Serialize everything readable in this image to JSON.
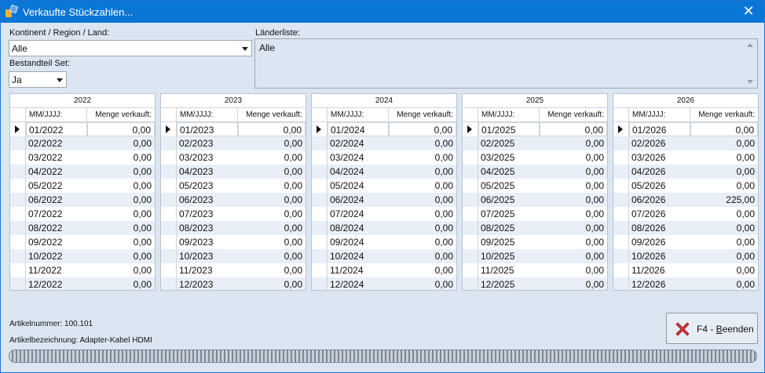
{
  "window": {
    "title": "Verkaufte Stückzahlen..."
  },
  "filters": {
    "region_label": "Kontinent / Region / Land:",
    "region_value": "Alle",
    "set_label": "Bestandteil Set:",
    "set_value": "Ja",
    "countries_label": "Länderliste:",
    "countries_value": "Alle"
  },
  "grid_headers": {
    "month": "MM/JJJJ:",
    "qty": "Menge verkauft:"
  },
  "years": [
    {
      "year": "2022",
      "rows": [
        {
          "m": "01/2022",
          "q": "0,00"
        },
        {
          "m": "02/2022",
          "q": "0,00"
        },
        {
          "m": "03/2022",
          "q": "0,00"
        },
        {
          "m": "04/2022",
          "q": "0,00"
        },
        {
          "m": "05/2022",
          "q": "0,00"
        },
        {
          "m": "06/2022",
          "q": "0,00"
        },
        {
          "m": "07/2022",
          "q": "0,00"
        },
        {
          "m": "08/2022",
          "q": "0,00"
        },
        {
          "m": "09/2022",
          "q": "0,00"
        },
        {
          "m": "10/2022",
          "q": "0,00"
        },
        {
          "m": "11/2022",
          "q": "0,00"
        },
        {
          "m": "12/2022",
          "q": "0,00"
        }
      ]
    },
    {
      "year": "2023",
      "rows": [
        {
          "m": "01/2023",
          "q": "0,00"
        },
        {
          "m": "02/2023",
          "q": "0,00"
        },
        {
          "m": "03/2023",
          "q": "0,00"
        },
        {
          "m": "04/2023",
          "q": "0,00"
        },
        {
          "m": "05/2023",
          "q": "0,00"
        },
        {
          "m": "06/2023",
          "q": "0,00"
        },
        {
          "m": "07/2023",
          "q": "0,00"
        },
        {
          "m": "08/2023",
          "q": "0,00"
        },
        {
          "m": "09/2023",
          "q": "0,00"
        },
        {
          "m": "10/2023",
          "q": "0,00"
        },
        {
          "m": "11/2023",
          "q": "0,00"
        },
        {
          "m": "12/2023",
          "q": "0,00"
        }
      ]
    },
    {
      "year": "2024",
      "rows": [
        {
          "m": "01/2024",
          "q": "0,00"
        },
        {
          "m": "02/2024",
          "q": "0,00"
        },
        {
          "m": "03/2024",
          "q": "0,00"
        },
        {
          "m": "04/2024",
          "q": "0,00"
        },
        {
          "m": "05/2024",
          "q": "0,00"
        },
        {
          "m": "06/2024",
          "q": "0,00"
        },
        {
          "m": "07/2024",
          "q": "0,00"
        },
        {
          "m": "08/2024",
          "q": "0,00"
        },
        {
          "m": "09/2024",
          "q": "0,00"
        },
        {
          "m": "10/2024",
          "q": "0,00"
        },
        {
          "m": "11/2024",
          "q": "0,00"
        },
        {
          "m": "12/2024",
          "q": "0,00"
        }
      ]
    },
    {
      "year": "2025",
      "rows": [
        {
          "m": "01/2025",
          "q": "0,00"
        },
        {
          "m": "02/2025",
          "q": "0,00"
        },
        {
          "m": "03/2025",
          "q": "0,00"
        },
        {
          "m": "04/2025",
          "q": "0,00"
        },
        {
          "m": "05/2025",
          "q": "0,00"
        },
        {
          "m": "06/2025",
          "q": "0,00"
        },
        {
          "m": "07/2025",
          "q": "0,00"
        },
        {
          "m": "08/2025",
          "q": "0,00"
        },
        {
          "m": "09/2025",
          "q": "0,00"
        },
        {
          "m": "10/2025",
          "q": "0,00"
        },
        {
          "m": "11/2025",
          "q": "0,00"
        },
        {
          "m": "12/2025",
          "q": "0,00"
        }
      ]
    },
    {
      "year": "2026",
      "rows": [
        {
          "m": "01/2026",
          "q": "0,00"
        },
        {
          "m": "02/2026",
          "q": "0,00"
        },
        {
          "m": "03/2026",
          "q": "0,00"
        },
        {
          "m": "04/2026",
          "q": "0,00"
        },
        {
          "m": "05/2026",
          "q": "0,00"
        },
        {
          "m": "06/2026",
          "q": "225,00"
        },
        {
          "m": "07/2026",
          "q": "0,00"
        },
        {
          "m": "08/2026",
          "q": "0,00"
        },
        {
          "m": "09/2026",
          "q": "0,00"
        },
        {
          "m": "10/2026",
          "q": "0,00"
        },
        {
          "m": "11/2026",
          "q": "0,00"
        },
        {
          "m": "12/2026",
          "q": "0,00"
        }
      ]
    }
  ],
  "article": {
    "number": "Artikelnummer: 100.101",
    "description": "Artikelbezeichnung: Adapter-Kabel HDMI"
  },
  "exit_button": {
    "prefix": "F4 - ",
    "accel": "B",
    "rest": "eenden"
  },
  "icons": {
    "app": "app-icon",
    "close": "close-icon",
    "exit": "red-x-icon"
  }
}
